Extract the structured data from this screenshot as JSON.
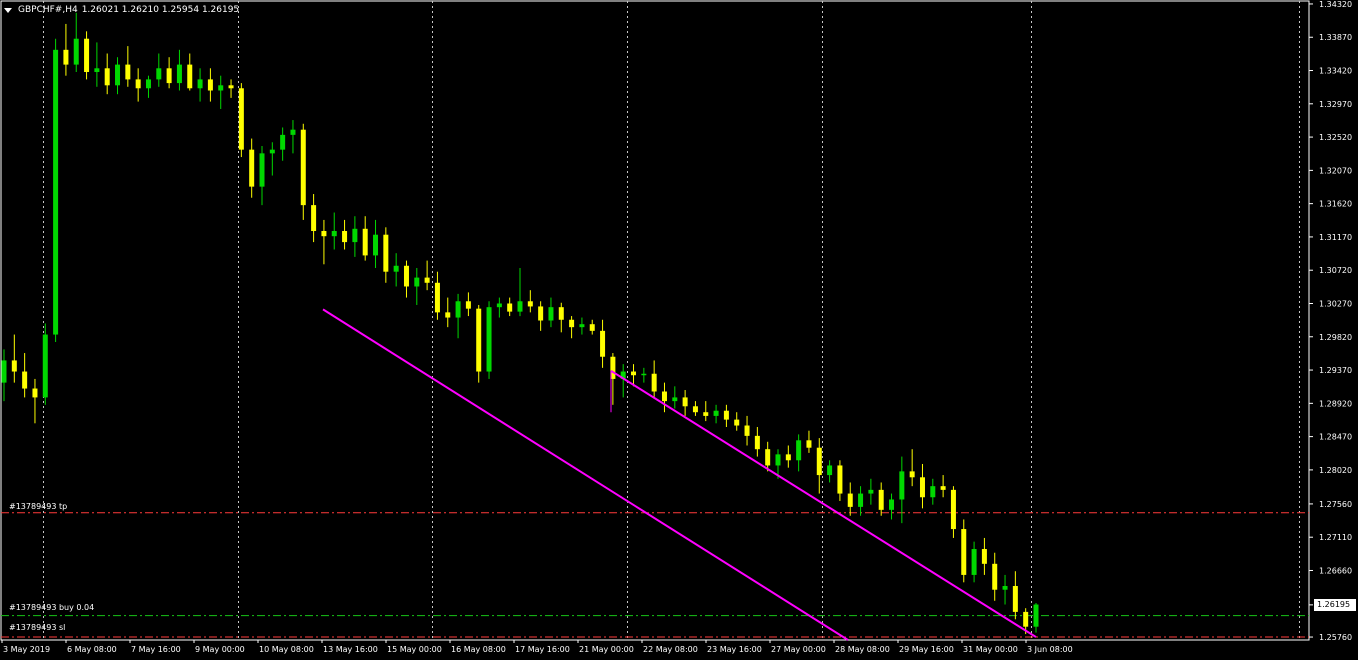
{
  "header": {
    "symbol": "GBPCHF#,H4",
    "ohlc": "1.26021 1.26210 1.25954 1.26195"
  },
  "order_lines": {
    "tp": {
      "label": "#13789493 tp",
      "color": "#ff3b3b"
    },
    "buy": {
      "label": "#13789493 buy 0.04",
      "color": "#17c417"
    },
    "sl": {
      "label": "#13789493 sl",
      "color": "#ff3b3b"
    }
  },
  "current_price": "1.26195",
  "colors": {
    "bull": "#00d800",
    "bear": "#ffff00",
    "channel": "#ff00ff",
    "grid": "#c8c8c8",
    "background": "#000000",
    "text": "#ffffff"
  },
  "chart_data": {
    "type": "candlestick",
    "y_ticks": [
      "1.34320",
      "1.33870",
      "1.33420",
      "1.32970",
      "1.32520",
      "1.32070",
      "1.31620",
      "1.31170",
      "1.30720",
      "1.30270",
      "1.29820",
      "1.29370",
      "1.28920",
      "1.28470",
      "1.28020",
      "1.27560",
      "1.27110",
      "1.26660",
      "1.26195",
      "1.25760"
    ],
    "ylim": [
      1.2572,
      1.3436
    ],
    "x_labels": [
      "3 May 2019",
      "6 May 08:00",
      "7 May 16:00",
      "9 May 00:00",
      "10 May 08:00",
      "13 May 16:00",
      "15 May 00:00",
      "16 May 08:00",
      "17 May 16:00",
      "21 May 00:00",
      "22 May 08:00",
      "23 May 16:00",
      "27 May 00:00",
      "28 May 08:00",
      "29 May 16:00",
      "31 May 00:00",
      "3 Jun 08:00"
    ],
    "grid": "vertical dotted",
    "levels": {
      "tp": 1.2744,
      "buy": 1.2605,
      "sl": 1.2576
    },
    "channel_lines": [
      {
        "from": [
          "13 May 16:00",
          1.3019
        ],
        "to": [
          "3 Jun 08:00+",
          1.2573
        ]
      },
      {
        "from": [
          "21 May 00:00",
          1.2936
        ],
        "to": [
          "3 Jun 08:00",
          1.259
        ]
      }
    ],
    "candles": [
      [
        1.292,
        1.2965,
        1.2895,
        1.295
      ],
      [
        1.295,
        1.2985,
        1.292,
        1.2935
      ],
      [
        1.2935,
        1.296,
        1.29,
        1.2912
      ],
      [
        1.2912,
        1.2925,
        1.2865,
        1.29
      ],
      [
        1.29,
        1.3,
        1.289,
        1.2985
      ],
      [
        1.2985,
        1.3385,
        1.2975,
        1.337
      ],
      [
        1.337,
        1.3405,
        1.3335,
        1.335
      ],
      [
        1.335,
        1.342,
        1.334,
        1.3385
      ],
      [
        1.3385,
        1.3395,
        1.333,
        1.334
      ],
      [
        1.334,
        1.338,
        1.332,
        1.3345
      ],
      [
        1.3345,
        1.3365,
        1.331,
        1.3322
      ],
      [
        1.3322,
        1.336,
        1.331,
        1.335
      ],
      [
        1.335,
        1.3375,
        1.332,
        1.333
      ],
      [
        1.333,
        1.3345,
        1.33,
        1.3318
      ],
      [
        1.3318,
        1.3335,
        1.3305,
        1.333
      ],
      [
        1.333,
        1.3365,
        1.332,
        1.3345
      ],
      [
        1.3345,
        1.336,
        1.3318,
        1.3325
      ],
      [
        1.3325,
        1.337,
        1.3315,
        1.335
      ],
      [
        1.335,
        1.3365,
        1.3315,
        1.3318
      ],
      [
        1.3318,
        1.3345,
        1.33,
        1.333
      ],
      [
        1.333,
        1.3345,
        1.33,
        1.3315
      ],
      [
        1.3315,
        1.3335,
        1.329,
        1.3322
      ],
      [
        1.3322,
        1.333,
        1.3305,
        1.3318
      ],
      [
        1.3318,
        1.3325,
        1.3225,
        1.3235
      ],
      [
        1.3235,
        1.325,
        1.317,
        1.3185
      ],
      [
        1.3185,
        1.324,
        1.316,
        1.323
      ],
      [
        1.323,
        1.3245,
        1.32,
        1.3235
      ],
      [
        1.3235,
        1.3265,
        1.322,
        1.3255
      ],
      [
        1.3255,
        1.3275,
        1.323,
        1.3262
      ],
      [
        1.3262,
        1.327,
        1.314,
        1.316
      ],
      [
        1.316,
        1.3175,
        1.311,
        1.3125
      ],
      [
        1.3125,
        1.314,
        1.308,
        1.3118
      ],
      [
        1.3118,
        1.315,
        1.31,
        1.3125
      ],
      [
        1.3125,
        1.314,
        1.31,
        1.311
      ],
      [
        1.311,
        1.3145,
        1.309,
        1.3128
      ],
      [
        1.3128,
        1.3145,
        1.3085,
        1.3092
      ],
      [
        1.3092,
        1.314,
        1.3075,
        1.312
      ],
      [
        1.312,
        1.313,
        1.3055,
        1.307
      ],
      [
        1.307,
        1.3095,
        1.305,
        1.3078
      ],
      [
        1.3078,
        1.3085,
        1.3035,
        1.305
      ],
      [
        1.305,
        1.3075,
        1.3025,
        1.3062
      ],
      [
        1.3062,
        1.3085,
        1.3045,
        1.3055
      ],
      [
        1.3055,
        1.307,
        1.3005,
        1.3015
      ],
      [
        1.3015,
        1.3035,
        1.2995,
        1.3008
      ],
      [
        1.3008,
        1.304,
        1.298,
        1.303
      ],
      [
        1.303,
        1.3042,
        1.301,
        1.302
      ],
      [
        1.302,
        1.3025,
        1.292,
        1.2935
      ],
      [
        1.2935,
        1.303,
        1.2925,
        1.3022
      ],
      [
        1.3022,
        1.3035,
        1.3008,
        1.3027
      ],
      [
        1.3027,
        1.3035,
        1.301,
        1.3016
      ],
      [
        1.3016,
        1.3075,
        1.301,
        1.303
      ],
      [
        1.303,
        1.3045,
        1.3015,
        1.3023
      ],
      [
        1.3023,
        1.303,
        1.299,
        1.3004
      ],
      [
        1.3004,
        1.3035,
        1.2995,
        1.3022
      ],
      [
        1.3022,
        1.3028,
        1.2988,
        1.3005
      ],
      [
        1.3005,
        1.301,
        1.298,
        1.2995
      ],
      [
        1.2995,
        1.3008,
        1.2985,
        1.2999
      ],
      [
        1.2999,
        1.3005,
        1.2985,
        1.299
      ],
      [
        1.299,
        1.3005,
        1.294,
        1.2955
      ],
      [
        1.2955,
        1.296,
        1.289,
        1.2925
      ],
      [
        1.2925,
        1.2945,
        1.29,
        1.2935
      ],
      [
        1.2935,
        1.2945,
        1.2915,
        1.293
      ],
      [
        1.293,
        1.294,
        1.292,
        1.2932
      ],
      [
        1.2932,
        1.295,
        1.29,
        1.2908
      ],
      [
        1.2908,
        1.292,
        1.288,
        1.2895
      ],
      [
        1.2895,
        1.2915,
        1.2885,
        1.29
      ],
      [
        1.29,
        1.291,
        1.2875,
        1.2888
      ],
      [
        1.2888,
        1.2895,
        1.2875,
        1.288
      ],
      [
        1.288,
        1.2895,
        1.2868,
        1.2875
      ],
      [
        1.2875,
        1.289,
        1.2865,
        1.2882
      ],
      [
        1.2882,
        1.289,
        1.286,
        1.287
      ],
      [
        1.287,
        1.288,
        1.2855,
        1.2862
      ],
      [
        1.2862,
        1.2875,
        1.2835,
        1.2848
      ],
      [
        1.2848,
        1.286,
        1.282,
        1.283
      ],
      [
        1.283,
        1.284,
        1.28,
        1.2808
      ],
      [
        1.2808,
        1.283,
        1.279,
        1.2823
      ],
      [
        1.2823,
        1.2835,
        1.2805,
        1.2815
      ],
      [
        1.2815,
        1.285,
        1.28,
        1.2842
      ],
      [
        1.2842,
        1.2855,
        1.2825,
        1.2832
      ],
      [
        1.2832,
        1.2845,
        1.277,
        1.2795
      ],
      [
        1.2795,
        1.2815,
        1.2785,
        1.2808
      ],
      [
        1.2808,
        1.2815,
        1.276,
        1.277
      ],
      [
        1.277,
        1.2785,
        1.274,
        1.2752
      ],
      [
        1.2752,
        1.278,
        1.274,
        1.277
      ],
      [
        1.277,
        1.279,
        1.2755,
        1.2775
      ],
      [
        1.2775,
        1.2785,
        1.274,
        1.2748
      ],
      [
        1.2748,
        1.277,
        1.2735,
        1.2762
      ],
      [
        1.2762,
        1.282,
        1.273,
        1.28
      ],
      [
        1.28,
        1.283,
        1.278,
        1.2792
      ],
      [
        1.2792,
        1.281,
        1.275,
        1.2765
      ],
      [
        1.2765,
        1.279,
        1.2755,
        1.278
      ],
      [
        1.278,
        1.2795,
        1.2765,
        1.2775
      ],
      [
        1.2775,
        1.278,
        1.271,
        1.2722
      ],
      [
        1.2722,
        1.2735,
        1.265,
        1.266
      ],
      [
        1.266,
        1.2705,
        1.265,
        1.2695
      ],
      [
        1.2695,
        1.271,
        1.266,
        1.2675
      ],
      [
        1.2675,
        1.269,
        1.2625,
        1.264
      ],
      [
        1.264,
        1.266,
        1.262,
        1.2645
      ],
      [
        1.2645,
        1.2665,
        1.26,
        1.261
      ],
      [
        1.261,
        1.2615,
        1.258,
        1.259
      ],
      [
        1.259,
        1.2622,
        1.2582,
        1.262
      ]
    ]
  }
}
